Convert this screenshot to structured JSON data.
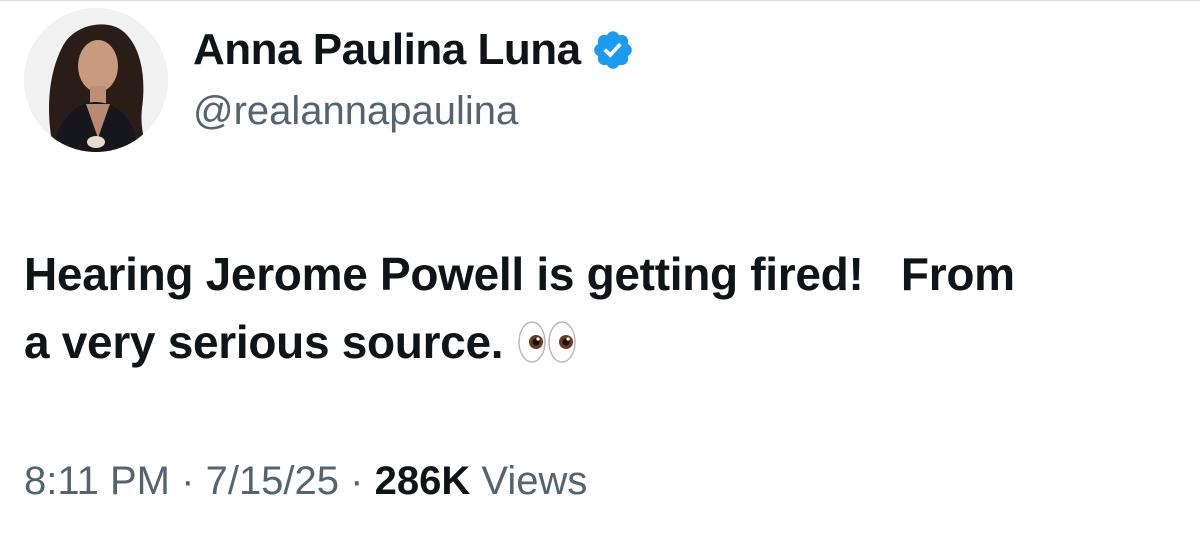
{
  "author": {
    "display_name": "Anna Paulina Luna",
    "handle": "@realannapaulina",
    "verified": true,
    "verified_color": "#1d9bf0"
  },
  "tweet": {
    "text_line_1": "Hearing Jerome Powell is getting fired!   From",
    "text_line_2": "a very serious source.",
    "emoji": "eyes-emoji"
  },
  "meta": {
    "time": "8:11 PM",
    "separator": "·",
    "date": "7/15/25",
    "views_count": "286K",
    "views_label": "Views"
  },
  "colors": {
    "text_primary": "#0f1419",
    "text_secondary": "#536471"
  }
}
